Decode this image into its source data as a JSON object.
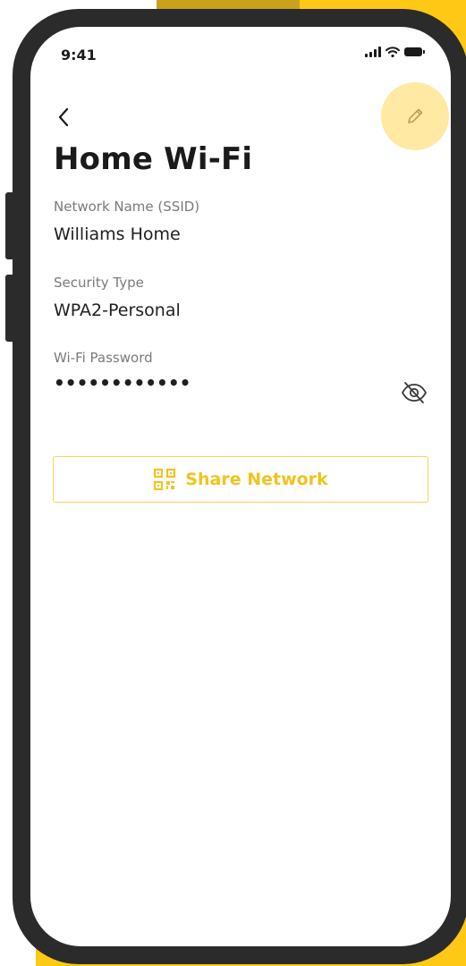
{
  "status_bar": {
    "time": "9:41"
  },
  "header": {
    "title": "Home Wi-Fi"
  },
  "fields": [
    {
      "label": "Network Name (SSID)",
      "value": "Williams Home"
    },
    {
      "label": "Security Type",
      "value": "WPA2-Personal"
    },
    {
      "label": "Wi-Fi Password",
      "value": "••••••••••••"
    }
  ],
  "share": {
    "label": "Share Network"
  },
  "icons": {
    "back": "chevron-left-icon",
    "edit": "pencil-icon",
    "password_toggle": "eye-off-icon",
    "share": "qr-code-icon"
  },
  "colors": {
    "accent": "#F2C31E",
    "accent_soft": "#FFE9A3",
    "background_yellow": "#FFC814",
    "phone_frame": "#2b2b2b"
  }
}
